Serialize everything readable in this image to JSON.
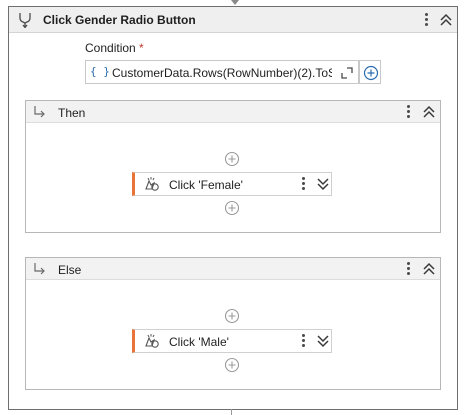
{
  "sequence": {
    "title": "Click Gender Radio Button",
    "icon": "if-branch-icon",
    "menu_icon": "more-vertical-icon",
    "collapse_icon": "double-chevron-up-icon"
  },
  "condition": {
    "label": "Condition",
    "required_marker": "*",
    "brace_icon": "{ }",
    "expression": "CustomerData.Rows(RowNumber)(2).ToSt",
    "expand_icon": "expand-editor-icon",
    "add_icon": "plus-circle-icon"
  },
  "then_branch": {
    "title": "Then",
    "activity": {
      "label": "Click 'Female'",
      "icon": "click-icon"
    }
  },
  "else_branch": {
    "title": "Else",
    "activity": {
      "label": "Click 'Male'",
      "icon": "click-icon"
    }
  },
  "colors": {
    "activity_accent": "#e8743b",
    "header_bg": "#efefef",
    "brace": "#2b6cb0"
  }
}
